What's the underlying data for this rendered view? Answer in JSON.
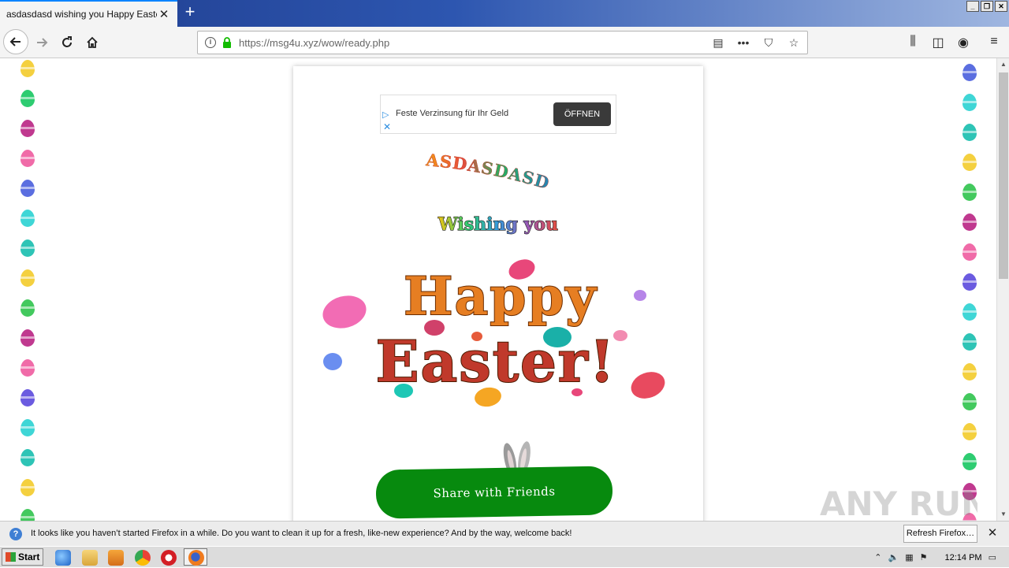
{
  "browser": {
    "tab_title": "asdasdasd wishing you Happy Easter",
    "url": "https://msg4u.xyz/wow/ready.php"
  },
  "page": {
    "ad_text": "Feste Verzinsung für Ihr Geld",
    "ad_button": "ÖFFNEN",
    "name": "ASDASDASD",
    "wishing": "Wishing you",
    "greeting_line1": "Happy",
    "greeting_line2": "Easter!",
    "share_button": "Share with Friends",
    "watermark": "ANY RUN"
  },
  "notification": {
    "message": "It looks like you haven’t started Firefox in a while. Do you want to clean it up for a fresh, like-new experience? And by the way, welcome back!",
    "button": "Refresh Firefox…"
  },
  "taskbar": {
    "start_label": "Start",
    "clock": "12:14 PM"
  },
  "egg_colors": [
    "#f4d03f",
    "#2ecc71",
    "#c0398f",
    "#f06ba8",
    "#5b6ee0",
    "#3fd6d6",
    "#2ec4b6",
    "#f4d03f",
    "#43c95e",
    "#c0398f",
    "#f06ba8",
    "#6b5be0",
    "#3fd6d6",
    "#2ec4b6",
    "#f4d03f",
    "#43c95e"
  ]
}
